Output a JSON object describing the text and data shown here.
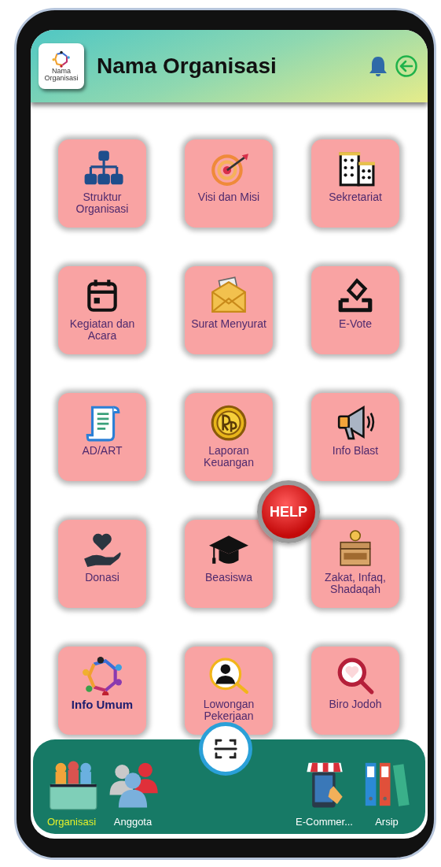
{
  "header": {
    "logo_caption": "Nama Organisasi",
    "title": "Nama Organisasi"
  },
  "menu": [
    {
      "label": "Struktur Organisasi",
      "kind": "org-chart",
      "selected": false
    },
    {
      "label": "Visi dan Misi",
      "kind": "target",
      "selected": false
    },
    {
      "label": "Sekretariat",
      "kind": "building",
      "selected": false
    },
    {
      "label": "Kegiatan dan Acara",
      "kind": "calendar",
      "selected": false
    },
    {
      "label": "Surat Menyurat",
      "kind": "envelope",
      "selected": false
    },
    {
      "label": "E-Vote",
      "kind": "ballot",
      "selected": false
    },
    {
      "label": "AD/ART",
      "kind": "scroll",
      "selected": false
    },
    {
      "label": "Laporan Keuangan",
      "kind": "coin",
      "selected": false
    },
    {
      "label": "Info Blast",
      "kind": "megaphone",
      "selected": false
    },
    {
      "label": "Donasi",
      "kind": "heart-hand",
      "selected": false
    },
    {
      "label": "Beasiswa",
      "kind": "grad-cap",
      "selected": false
    },
    {
      "label": "Zakat, Infaq, Shadaqah",
      "kind": "donation-box",
      "selected": false
    },
    {
      "label": "Info Umum",
      "kind": "people-ring",
      "selected": true
    },
    {
      "label": "Lowongan Pekerjaan",
      "kind": "person-search",
      "selected": false
    },
    {
      "label": "Biro Jodoh",
      "kind": "heart-search",
      "selected": false
    }
  ],
  "help_button": "HELP",
  "bottom_nav": [
    {
      "label": "Organisasi",
      "kind": "group-box",
      "selected": true
    },
    {
      "label": "Anggota",
      "kind": "people",
      "selected": false
    },
    {
      "label": "E-Commer...",
      "kind": "shop-phone",
      "selected": false
    },
    {
      "label": "Arsip",
      "kind": "binders",
      "selected": false
    }
  ]
}
